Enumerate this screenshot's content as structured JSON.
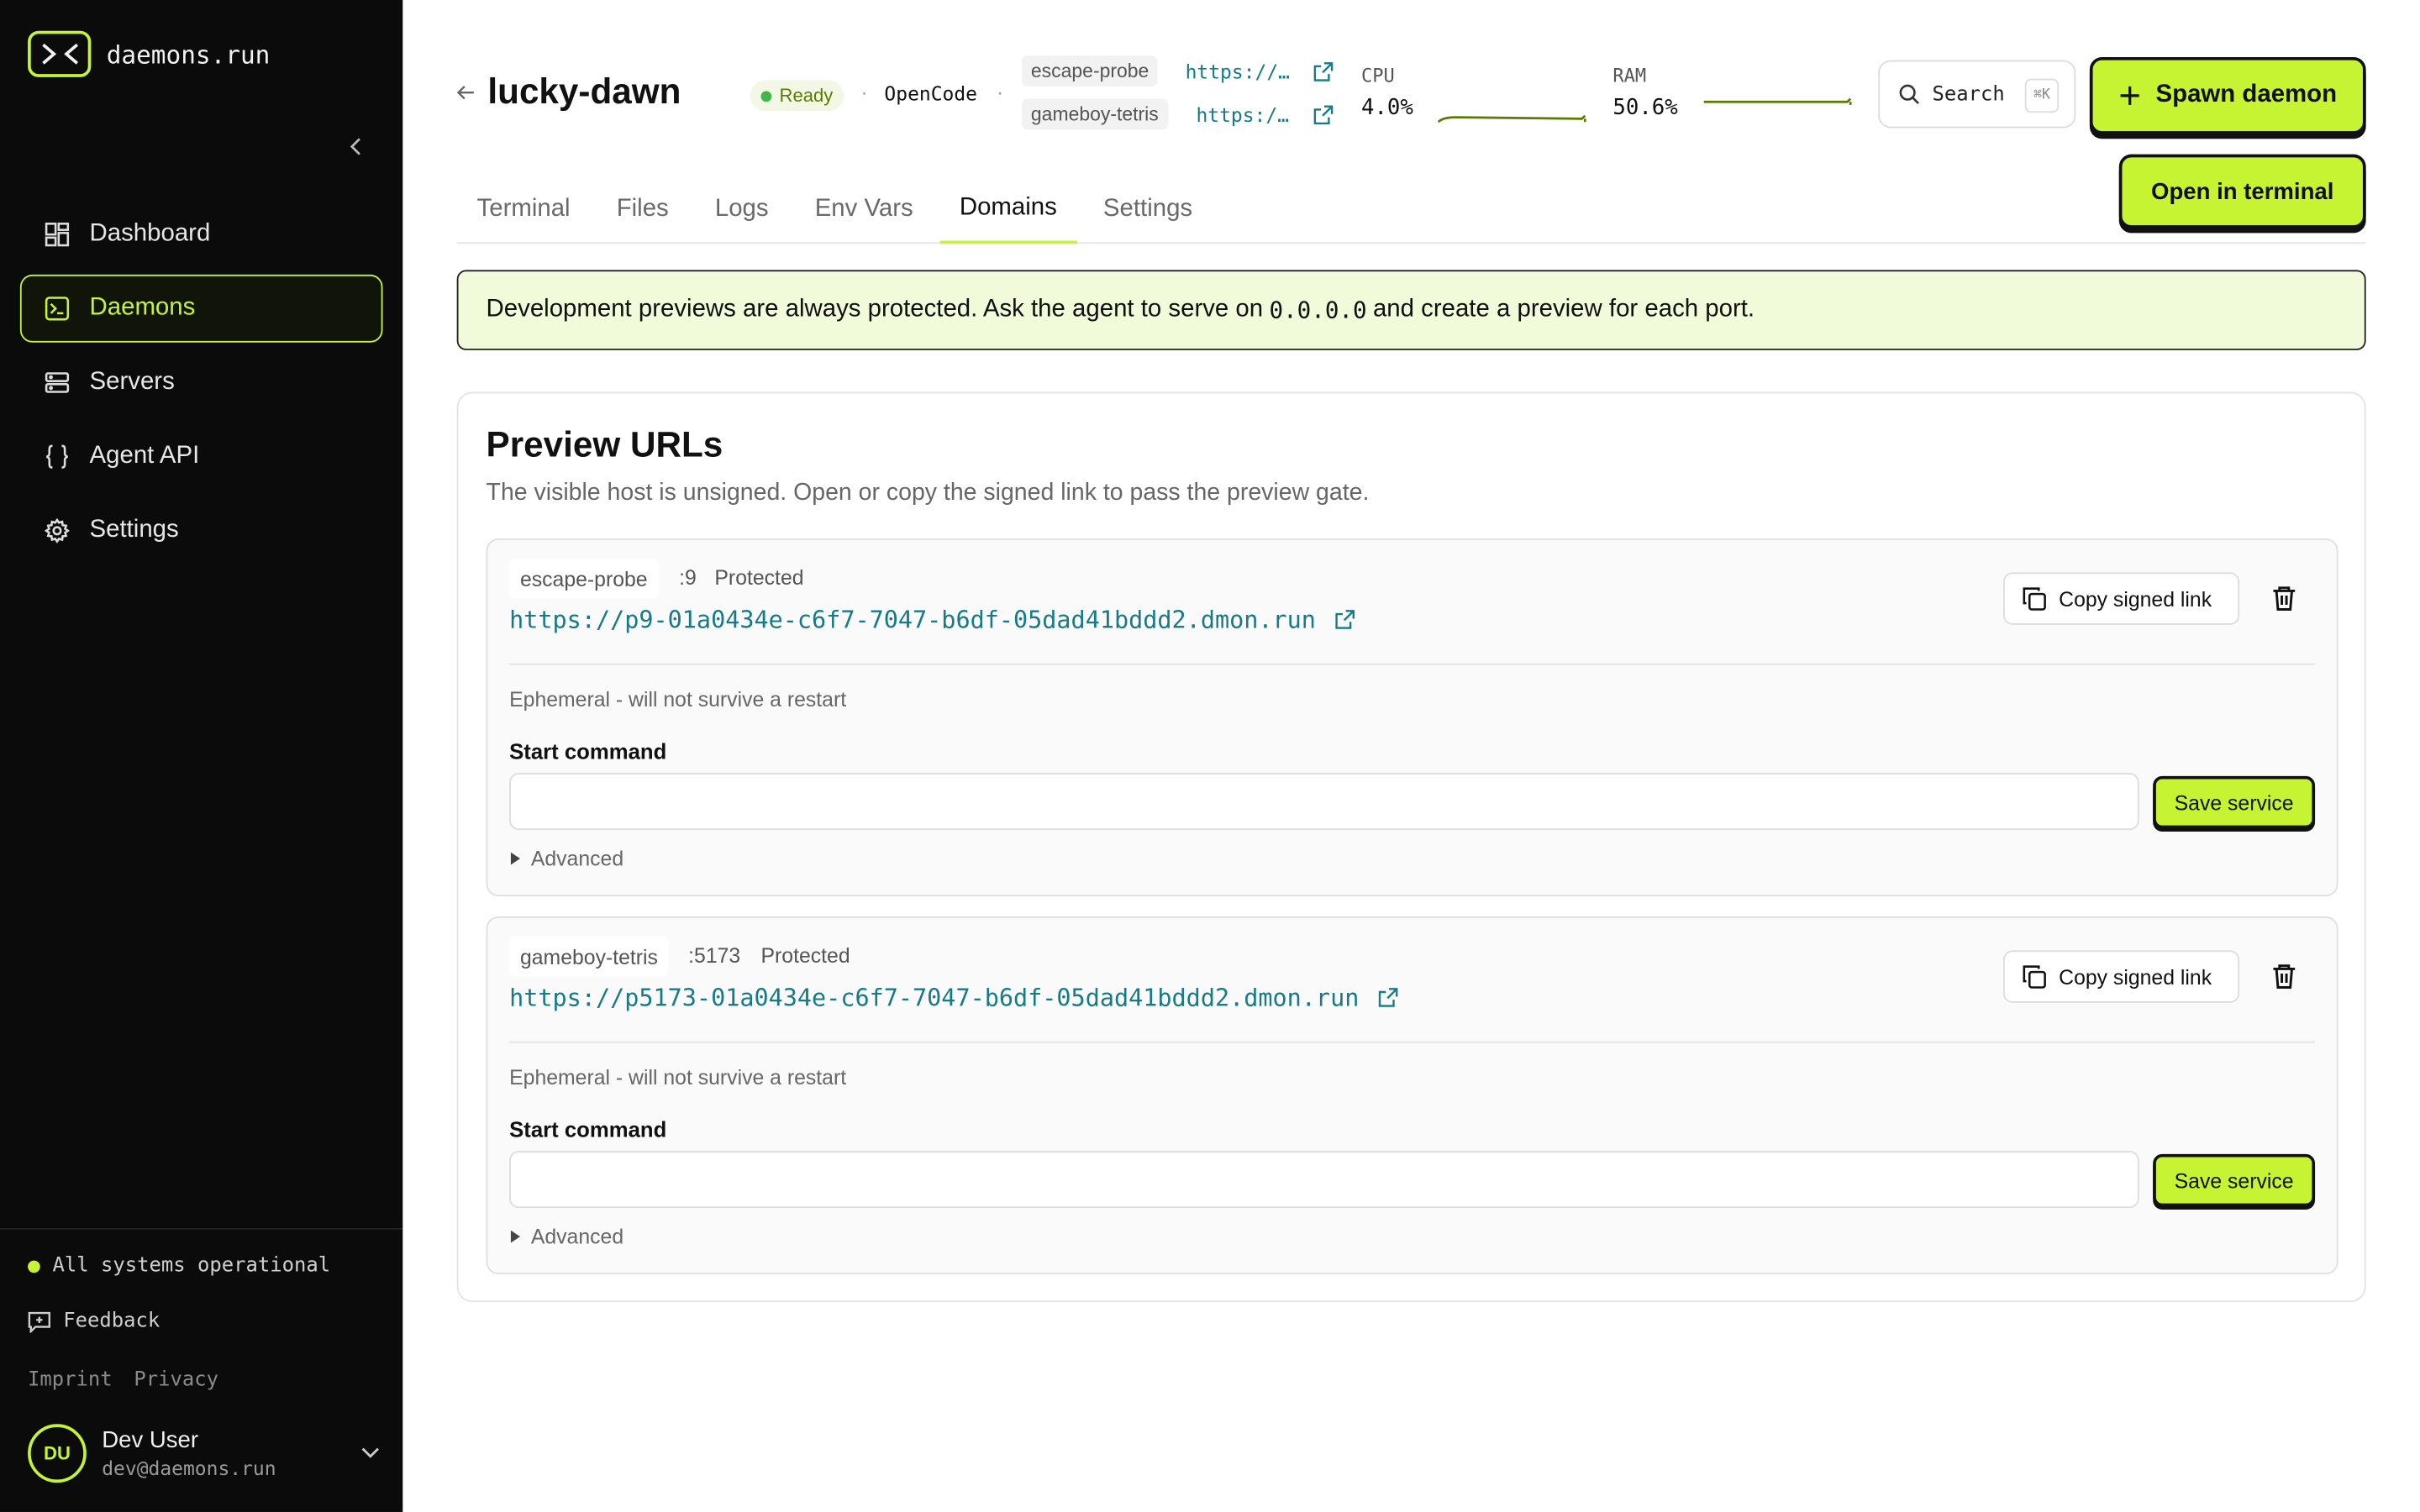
{
  "brand": {
    "name": "daemons.run"
  },
  "sidebar": {
    "items": [
      {
        "label": "Dashboard",
        "icon": "dashboard-icon"
      },
      {
        "label": "Daemons",
        "icon": "terminal-icon",
        "active": true
      },
      {
        "label": "Servers",
        "icon": "server-icon"
      },
      {
        "label": "Agent API",
        "icon": "braces-icon"
      },
      {
        "label": "Settings",
        "icon": "gear-icon"
      }
    ],
    "status": "All systems operational",
    "feedback": "Feedback",
    "legal": {
      "imprint": "Imprint",
      "privacy": "Privacy"
    },
    "user": {
      "initials": "DU",
      "name": "Dev User",
      "email": "dev@daemons.run"
    }
  },
  "header": {
    "title": "lucky-dawn",
    "status": "Ready",
    "agent": "OpenCode",
    "separator": "·",
    "services": [
      {
        "name": "escape-probe",
        "link": "https://…"
      },
      {
        "name": "gameboy-tetris",
        "link": "https:/…"
      }
    ],
    "cpu": {
      "label": "CPU",
      "value": "4.0%"
    },
    "ram": {
      "label": "RAM",
      "value": "50.6%"
    },
    "search": {
      "label": "Search",
      "shortcut": "⌘K"
    },
    "spawn_label": "Spawn daemon",
    "terminal_label": "Open in terminal"
  },
  "tabs": [
    {
      "label": "Terminal"
    },
    {
      "label": "Files"
    },
    {
      "label": "Logs"
    },
    {
      "label": "Env Vars"
    },
    {
      "label": "Domains",
      "active": true
    },
    {
      "label": "Settings"
    }
  ],
  "notice": {
    "before": "Development previews are always protected. Ask the agent to serve on",
    "code": "0.0.0.0",
    "after": "and create a preview for each port."
  },
  "preview": {
    "title": "Preview URLs",
    "subtitle": "The visible host is unsigned. Open or copy the signed link to pass the preview gate.",
    "cards": [
      {
        "service": "escape-probe",
        "port": ":9",
        "protection": "Protected",
        "url": "https://p9-01a0434e-c6f7-7047-b6df-05dad41bddd2.dmon.run",
        "copy_label": "Copy signed link",
        "ephemeral": "Ephemeral - will not survive a restart",
        "start_label": "Start command",
        "start_value": "",
        "save_label": "Save service",
        "advanced_label": "Advanced"
      },
      {
        "service": "gameboy-tetris",
        "port": ":5173",
        "protection": "Protected",
        "url": "https://p5173-01a0434e-c6f7-7047-b6df-05dad41bddd2.dmon.run",
        "copy_label": "Copy signed link",
        "ephemeral": "Ephemeral - will not survive a restart",
        "start_label": "Start command",
        "start_value": "",
        "save_label": "Save service",
        "advanced_label": "Advanced"
      }
    ]
  },
  "colors": {
    "accent": "#c6f432",
    "sidebar_bg": "#0b0b0b",
    "link": "#167a87",
    "ready": "#43b649"
  }
}
